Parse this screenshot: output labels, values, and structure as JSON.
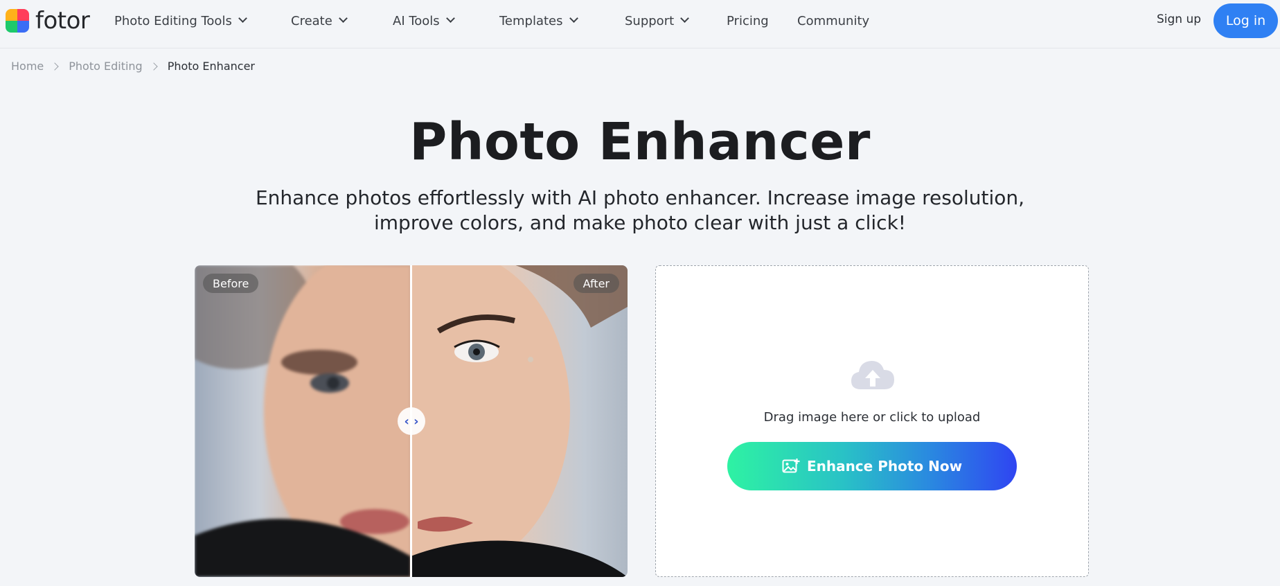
{
  "brand": {
    "name": "fotor"
  },
  "nav": {
    "items": [
      {
        "label": "Photo Editing Tools",
        "dropdown": true
      },
      {
        "label": "Create",
        "dropdown": true
      },
      {
        "label": "AI Tools",
        "dropdown": true
      },
      {
        "label": "Templates",
        "dropdown": true
      },
      {
        "label": "Support",
        "dropdown": true
      },
      {
        "label": "Pricing",
        "dropdown": false
      },
      {
        "label": "Community",
        "dropdown": false
      }
    ],
    "signup_label": "Sign up",
    "login_label": "Log in"
  },
  "breadcrumb": {
    "items": [
      "Home",
      "Photo Editing",
      "Photo Enhancer"
    ]
  },
  "hero": {
    "title": "Photo Enhancer",
    "subtitle_line1": "Enhance photos effortlessly with AI photo enhancer. Increase image resolution,",
    "subtitle_line2": "improve colors, and make photo clear with just a click!"
  },
  "compare": {
    "before_label": "Before",
    "after_label": "After",
    "handle_glyph": "‹ ›"
  },
  "upload": {
    "prompt": "Drag image here or click to upload",
    "button_label": "Enhance Photo Now",
    "icon": "cloud-upload-icon"
  },
  "colors": {
    "accent": "#2f80f3",
    "page_bg": "#f3f5f8",
    "gradient_start": "#2ef2a3",
    "gradient_end": "#2f45f2"
  }
}
